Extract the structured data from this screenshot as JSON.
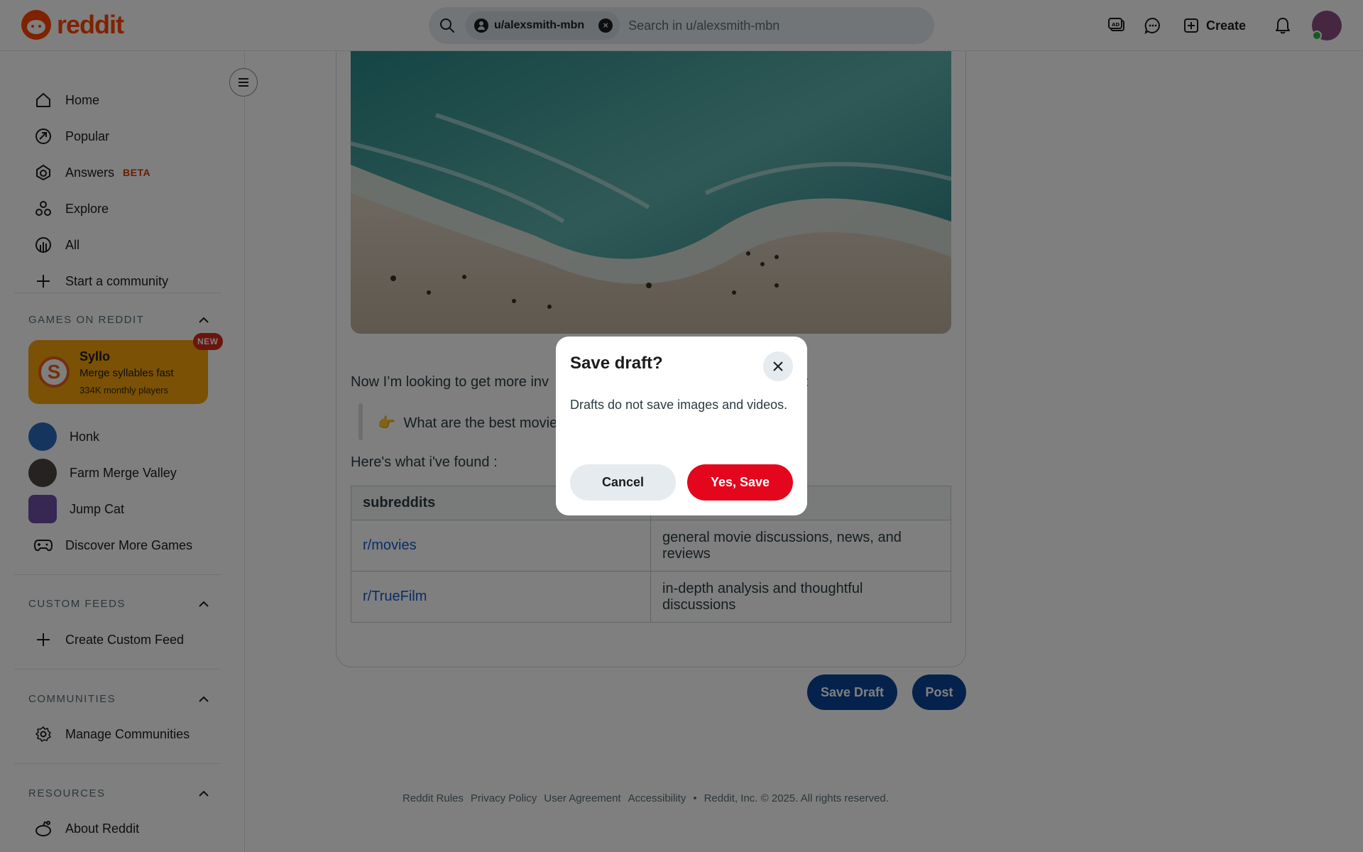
{
  "header": {
    "logo_text": "reddit",
    "search_chip": "u/alexsmith-mbn",
    "search_placeholder": "Search in u/alexsmith-mbn",
    "create_label": "Create"
  },
  "sidebar": {
    "nav": [
      {
        "label": "Home",
        "icon": "home-icon"
      },
      {
        "label": "Popular",
        "icon": "popular-icon"
      },
      {
        "label": "Answers",
        "icon": "answers-icon",
        "badge": "BETA"
      },
      {
        "label": "Explore",
        "icon": "explore-icon"
      },
      {
        "label": "All",
        "icon": "all-icon"
      },
      {
        "label": "Start a community",
        "icon": "plus-icon"
      }
    ],
    "games_title": "GAMES ON REDDIT",
    "featured_game": {
      "name": "Syllo",
      "tagline": "Merge syllables fast",
      "players": "334K monthly players",
      "badge": "NEW"
    },
    "games": [
      "Honk",
      "Farm Merge Valley",
      "Jump Cat"
    ],
    "discover_games": "Discover More Games",
    "custom_feeds_title": "CUSTOM FEEDS",
    "create_custom_feed": "Create Custom Feed",
    "communities_title": "COMMUNITIES",
    "manage_communities": "Manage Communities",
    "resources_title": "RESOURCES",
    "about_reddit": "About Reddit"
  },
  "post": {
    "paragraph_visible": "Now I’m looking to get more inv",
    "paragraph_tail": "k:",
    "quote_emoji": "👉",
    "quote_visible": "What are the best movie",
    "found_text": "Here's what i've found :",
    "table": {
      "header": "subreddits",
      "rows": [
        {
          "sub": "r/movies",
          "desc": "general movie discussions, news, and reviews"
        },
        {
          "sub": "r/TrueFilm",
          "desc": "in-depth analysis and thoughtful discussions"
        }
      ]
    },
    "save_draft_label": "Save Draft",
    "post_label": "Post"
  },
  "footer": {
    "links": [
      "Reddit Rules",
      "Privacy Policy",
      "User Agreement",
      "Accessibility"
    ],
    "copyright": "Reddit, Inc. © 2025. All rights reserved."
  },
  "modal": {
    "title": "Save draft?",
    "message": "Drafts do not save images and videos.",
    "cancel_label": "Cancel",
    "confirm_label": "Yes, Save"
  },
  "colors": {
    "brand": "#ff4500",
    "primary_button": "#0a449b",
    "confirm_button": "#e3061c",
    "link": "#115bca"
  }
}
